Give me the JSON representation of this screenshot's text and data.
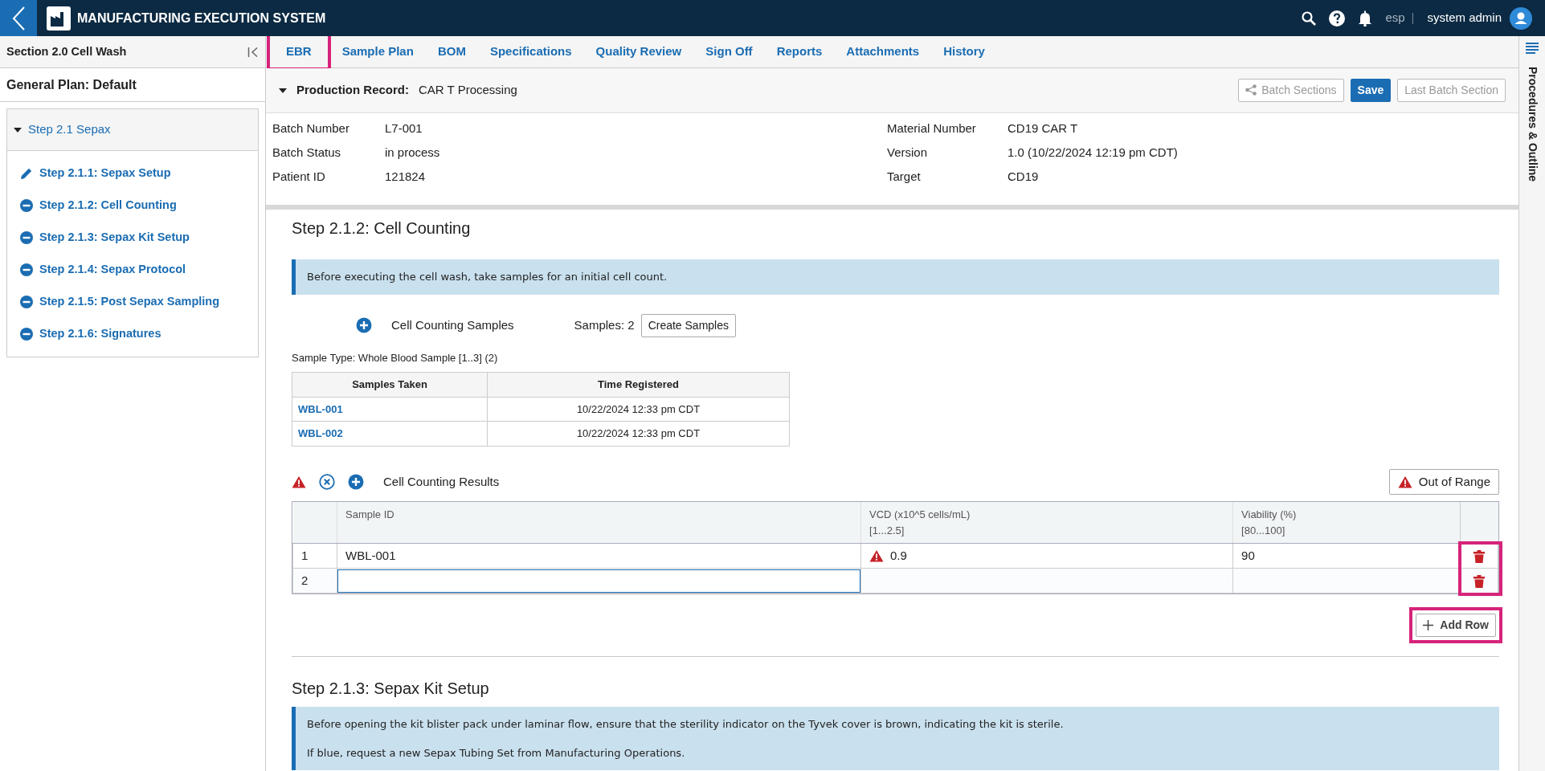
{
  "app": {
    "title": "MANUFACTURING EXECUTION SYSTEM",
    "language": "esp",
    "separator": "|",
    "user": "system admin"
  },
  "sidebar": {
    "section_title": "Section 2.0 Cell Wash",
    "plan_title": "General Plan: Default",
    "tree": [
      {
        "label": "Step 2.1 Sepax",
        "expanded": true,
        "children": [
          {
            "label": "Step 2.1.1: Sepax Setup",
            "kind": "edit"
          },
          {
            "label": "Step 2.1.2: Cell Counting",
            "kind": "pending"
          },
          {
            "label": "Step 2.1.3: Sepax Kit Setup",
            "kind": "pending"
          },
          {
            "label": "Step 2.1.4: Sepax Protocol",
            "kind": "pending"
          },
          {
            "label": "Step 2.1.5: Post Sepax Sampling",
            "kind": "pending"
          },
          {
            "label": "Step 2.1.6: Signatures",
            "kind": "pending"
          }
        ]
      }
    ]
  },
  "tabs": [
    {
      "label": "EBR",
      "highlighted": true
    },
    {
      "label": "Sample Plan",
      "highlighted": false
    },
    {
      "label": "BOM",
      "highlighted": false
    },
    {
      "label": "Specifications",
      "highlighted": false
    },
    {
      "label": "Quality Review",
      "highlighted": false
    },
    {
      "label": "Sign Off",
      "highlighted": false
    },
    {
      "label": "Reports",
      "highlighted": false
    },
    {
      "label": "Attachments",
      "highlighted": false
    },
    {
      "label": "History",
      "highlighted": false
    }
  ],
  "record": {
    "label": "Production Record:",
    "value": "CAR T Processing",
    "expanded": true,
    "buttons": [
      {
        "label": "Batch Sections",
        "kind": "share",
        "disabled": true
      },
      {
        "label": "Save",
        "kind": "primary",
        "disabled": false
      },
      {
        "label": "Last Batch Section",
        "kind": "plain",
        "disabled": true
      }
    ]
  },
  "details_left": [
    {
      "label": "Batch Number",
      "value": "L7-001"
    },
    {
      "label": "Batch Status",
      "value": "in process"
    },
    {
      "label": "Patient ID",
      "value": "121824"
    }
  ],
  "details_right": [
    {
      "label": "Material Number",
      "value": "CD19 CAR T"
    },
    {
      "label": "Version",
      "value": "1.0 (10/22/2024 12:19 pm CDT)"
    },
    {
      "label": "Target",
      "value": "CD19"
    }
  ],
  "steps": [
    {
      "title": "Step 2.1.2: Cell Counting",
      "notes": [
        "Before executing the cell wash, take samples for an initial cell count."
      ],
      "samples": {
        "title": "Cell Counting Samples",
        "count_label": "Samples: 2",
        "button": "Create Samples",
        "sample_type": "Sample Type: Whole Blood Sample [1..3] (2)",
        "columns": [
          "Samples Taken",
          "Time Registered"
        ],
        "rows": [
          [
            "WBL-001",
            "10/22/2024 12:33 pm CDT"
          ],
          [
            "WBL-002",
            "10/22/2024 12:33 pm CDT"
          ]
        ]
      },
      "results": {
        "title": "Cell Counting Results",
        "status_button": "Out of Range",
        "columns": [
          {
            "label": "Sample ID"
          },
          {
            "label": "VCD (x10^5 cells/mL)",
            "range": "[1...2.5]"
          },
          {
            "label": "Viability (%)",
            "range": "[80...100]"
          }
        ],
        "rows": [
          {
            "number": "1",
            "cells": [
              {
                "kind": "text",
                "value": "WBL-001"
              },
              {
                "kind": "text",
                "value": "0.9",
                "out_of_range": true
              },
              {
                "kind": "text",
                "value": "90"
              }
            ]
          },
          {
            "number": "2",
            "cells": [
              {
                "kind": "input"
              },
              {
                "kind": "empty"
              },
              {
                "kind": "empty"
              }
            ]
          }
        ],
        "delete_highlighted": true,
        "add_row": {
          "label": "Add Row",
          "highlighted": true
        }
      }
    },
    {
      "title": "Step 2.1.3: Sepax Kit Setup",
      "notes": [
        "Before opening the kit blister pack under laminar flow, ensure that the sterility indicator on the Tyvek cover is brown, indicating the kit is sterile.",
        "If blue, request a new Sepax Tubing Set from Manufacturing Operations."
      ]
    }
  ],
  "right_rail": {
    "label": "Procedures & Outline"
  }
}
